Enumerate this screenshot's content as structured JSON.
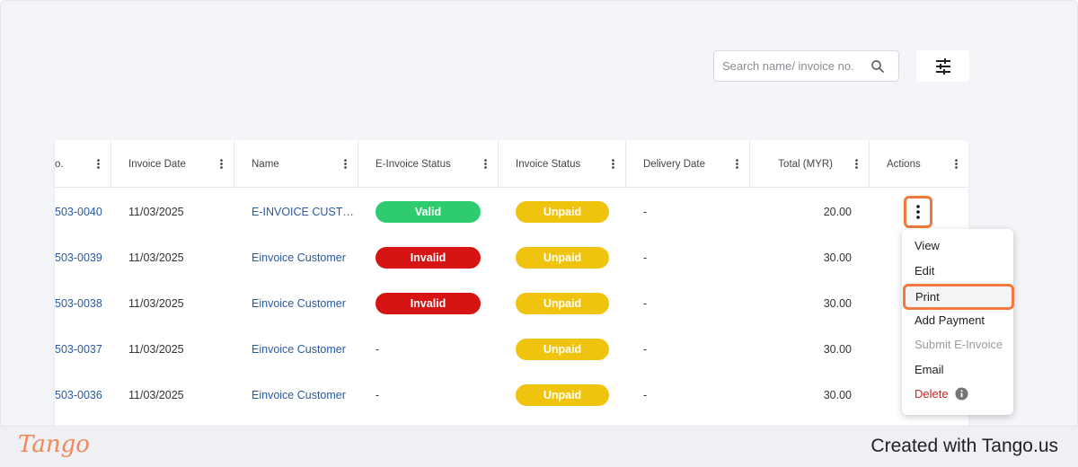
{
  "search": {
    "placeholder": "Search name/ invoice no."
  },
  "icons": {
    "search": "search-icon",
    "filter": "sliders-icon",
    "kebab": "more-vertical-icon",
    "info": "info-icon"
  },
  "columns": [
    {
      "key": "no",
      "label": "o."
    },
    {
      "key": "date",
      "label": "Invoice Date"
    },
    {
      "key": "name",
      "label": "Name"
    },
    {
      "key": "einvoice",
      "label": "E-Invoice Status"
    },
    {
      "key": "status",
      "label": "Invoice Status"
    },
    {
      "key": "delivery",
      "label": "Delivery Date"
    },
    {
      "key": "total",
      "label": "Total (MYR)"
    },
    {
      "key": "actions",
      "label": "Actions"
    }
  ],
  "rows": [
    {
      "no": "503-0040",
      "date": "11/03/2025",
      "name": "E-INVOICE CUST…",
      "einvoice": "Valid",
      "status": "Unpaid",
      "delivery": "-",
      "total": "20.00"
    },
    {
      "no": "503-0039",
      "date": "11/03/2025",
      "name": "Einvoice Customer",
      "einvoice": "Invalid",
      "status": "Unpaid",
      "delivery": "-",
      "total": "30.00"
    },
    {
      "no": "503-0038",
      "date": "11/03/2025",
      "name": "Einvoice Customer",
      "einvoice": "Invalid",
      "status": "Unpaid",
      "delivery": "-",
      "total": "30.00"
    },
    {
      "no": "503-0037",
      "date": "11/03/2025",
      "name": "Einvoice Customer",
      "einvoice": "-",
      "status": "Unpaid",
      "delivery": "-",
      "total": "30.00"
    },
    {
      "no": "503-0036",
      "date": "11/03/2025",
      "name": "Einvoice Customer",
      "einvoice": "-",
      "status": "Unpaid",
      "delivery": "-",
      "total": "30.00"
    }
  ],
  "menu": {
    "view": "View",
    "edit": "Edit",
    "print": "Print",
    "add_payment": "Add Payment",
    "submit_einvoice": "Submit E-Invoice",
    "email": "Email",
    "delete": "Delete"
  },
  "colors": {
    "valid": "#2ecc6f",
    "invalid": "#d71414",
    "unpaid": "#f0c30f",
    "highlight": "#f07a3e",
    "link": "#2a5a9e",
    "danger": "#c62828"
  },
  "footer": {
    "logo": "Tango",
    "created": "Created with Tango.us"
  }
}
